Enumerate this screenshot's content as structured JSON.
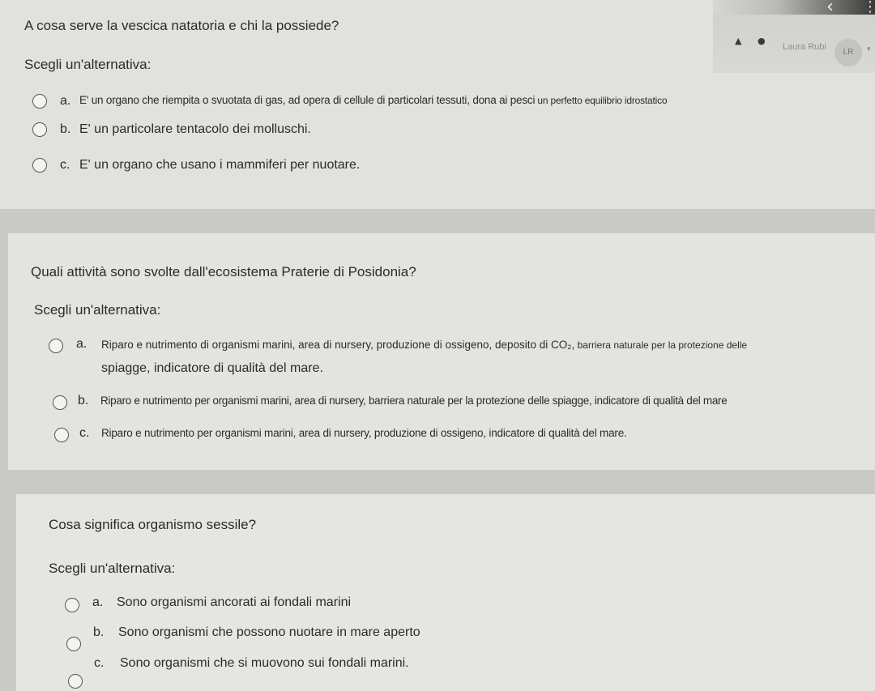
{
  "header": {
    "user_name": "Laura Rubi",
    "avatar_initials": "LR",
    "icons": [
      "back-arrow-icon",
      "kebab-menu-icon",
      "bell-icon",
      "chat-icon",
      "chevron-down-icon"
    ]
  },
  "questions": [
    {
      "text": "A cosa serve la vescica natatoria e chi la possiede?",
      "prompt": "Scegli un'alternativa:",
      "options": [
        {
          "letter": "a.",
          "text": "E' un organo che riempita o svuotata di gas, ad opera di cellule di particolari tessuti, dona ai pesci",
          "text_tail": " un perfetto equilibrio idrostatico"
        },
        {
          "letter": "b.",
          "text": "E' un particolare tentacolo dei molluschi."
        },
        {
          "letter": "c.",
          "text": "E' un organo che usano i mammiferi per nuotare."
        }
      ]
    },
    {
      "text": "Quali attività sono svolte dall'ecosistema Praterie di Posidonia?",
      "prompt": "Scegli un'alternativa:",
      "options": [
        {
          "letter": "a.",
          "text": "Riparo e nutrimento di organismi marini, area di nursery, produzione di ossigeno, deposito di CO₂,",
          "text_tail": " barriera naturale per la protezione delle",
          "text_line2": "spiagge, indicatore di qualità del mare."
        },
        {
          "letter": "b.",
          "text": "Riparo e nutrimento per organismi marini, area di nursery, barriera naturale per la protezione delle spiagge, indicatore di qualità del mare"
        },
        {
          "letter": "c.",
          "text": "Riparo e nutrimento per organismi marini, area di nursery, produzione di ossigeno, indicatore di qualità del mare."
        }
      ]
    },
    {
      "text": "Cosa significa organismo sessile?",
      "prompt": "Scegli un'alternativa:",
      "options": [
        {
          "letter": "a.",
          "text": "Sono organismi ancorati ai fondali marini"
        },
        {
          "letter": "b.",
          "text": "Sono organismi che possono nuotare in mare aperto"
        },
        {
          "letter": "c.",
          "text": "Sono organismi che si muovono sui fondali marini."
        }
      ]
    }
  ]
}
